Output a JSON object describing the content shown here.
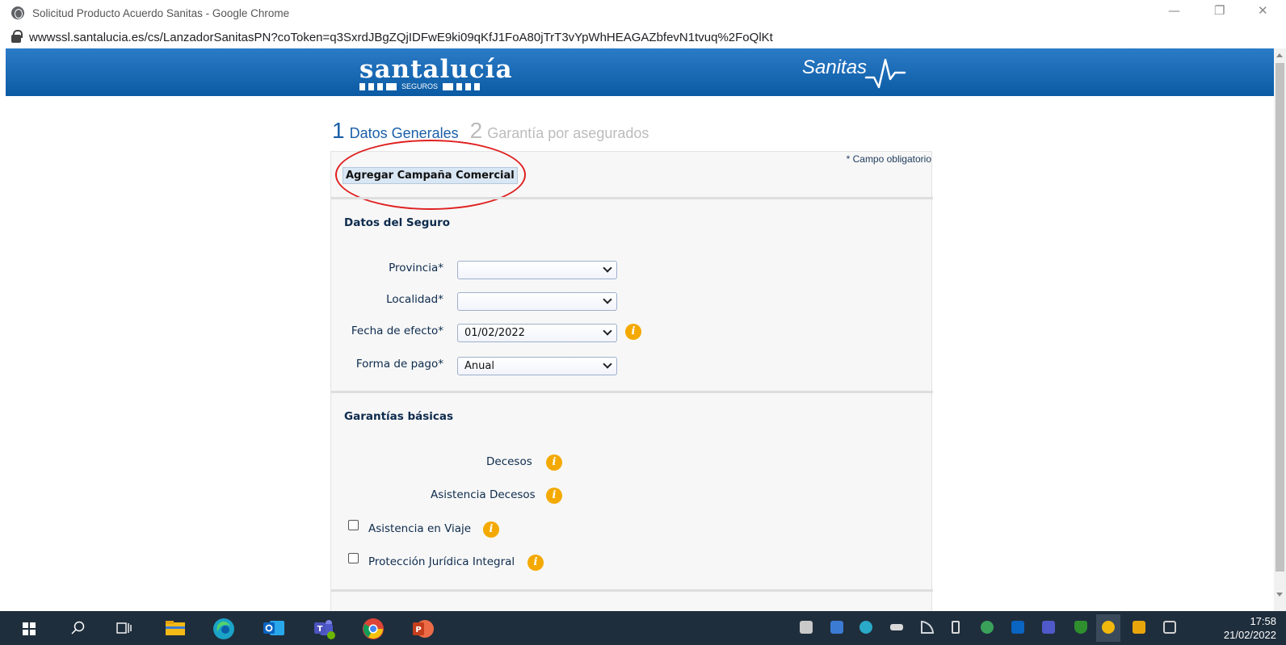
{
  "browser": {
    "window_title": "Solicitud Producto Acuerdo Sanitas - Google Chrome",
    "url_host": "wwwssl.santalucia.es",
    "url_rest": "/cs/LanzadorSanitasPN?coToken=q3SxrdJBgZQjIDFwE9ki09qKfJ1FoA80jTrT3vYpWhHEAGAZbfevN1tvuq%2FoQlKt",
    "minimize": "—",
    "restore": "❐",
    "close": "✕"
  },
  "header": {
    "brand_left": "santalucía",
    "brand_left_sub": "SEGUROS",
    "brand_right": "Sanitas"
  },
  "steps": [
    {
      "num": "1",
      "label": "Datos Generales",
      "active": true
    },
    {
      "num": "2",
      "label": "Garantía por asegurados",
      "active": false
    }
  ],
  "form": {
    "required_note": "* Campo obligatorio",
    "campaign_button": "Agregar Campaña Comercial",
    "seguro_title": "Datos del Seguro",
    "fields": [
      {
        "label": "Provincia*",
        "value": ""
      },
      {
        "label": "Localidad*",
        "value": ""
      },
      {
        "label": "Fecha de efecto*",
        "value": "01/02/2022"
      },
      {
        "label": "Forma de pago*",
        "value": "Anual"
      }
    ],
    "garantias_title": "Garantías básicas",
    "garantias": [
      {
        "label": "Decesos"
      },
      {
        "label": "Asistencia Decesos"
      },
      {
        "label": "Asistencia en Viaje",
        "checked": false
      },
      {
        "label": "Protección Jurídica Integral",
        "checked": false
      }
    ],
    "info_glyph": "i"
  },
  "taskbar": {
    "time": "17:58",
    "date": "21/02/2022"
  },
  "colors": {
    "header_blue": "#0a5aa3",
    "step_active": "#1a5fa8",
    "info_orange": "#f4a900",
    "highlight_red": "#e02020"
  }
}
